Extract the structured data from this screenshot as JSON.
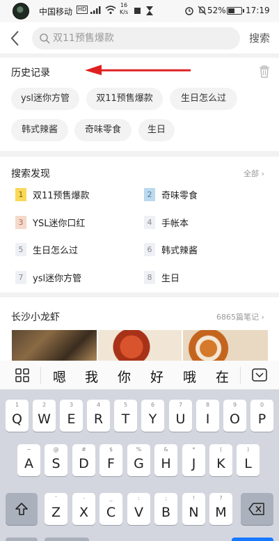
{
  "status_bar": {
    "carrier": "中国移动",
    "network_badge": "HD",
    "speed_value": "16",
    "speed_unit": "K/s",
    "battery": "52%",
    "battery_level": 0.52,
    "time": "17:19"
  },
  "search": {
    "placeholder": "双11预售爆款",
    "button": "搜索"
  },
  "history": {
    "title": "历史记录",
    "chips": [
      "ysl迷你方管",
      "双11预售爆款",
      "生日怎么过",
      "韩式辣酱",
      "奇味零食",
      "生日"
    ]
  },
  "discover": {
    "title": "搜索发现",
    "all": "全部",
    "items": [
      {
        "rank": "1",
        "label": "双11预售爆款",
        "color": "#fbd85a",
        "num_color": "#7a6200"
      },
      {
        "rank": "2",
        "label": "奇味零食",
        "color": "#bcd9ee",
        "num_color": "#4f7fa3"
      },
      {
        "rank": "3",
        "label": "YSL迷你口红",
        "color": "#f4d9cc",
        "num_color": "#b36b52"
      },
      {
        "rank": "4",
        "label": "手帐本",
        "color": "#eef0f6",
        "num_color": "#888888"
      },
      {
        "rank": "5",
        "label": "生日怎么过",
        "color": "#eef0f6",
        "num_color": "#888888"
      },
      {
        "rank": "6",
        "label": "韩式辣酱",
        "color": "#eef0f6",
        "num_color": "#888888"
      },
      {
        "rank": "7",
        "label": "ysl迷你方管",
        "color": "#eef0f6",
        "num_color": "#888888"
      },
      {
        "rank": "8",
        "label": "生日",
        "color": "#eef0f6",
        "num_color": "#888888"
      }
    ]
  },
  "city": {
    "title": "长沙小龙虾",
    "notes": "6865篇笔记"
  },
  "keyboard": {
    "candidates": [
      "嗯",
      "我",
      "你",
      "好",
      "哦",
      "在"
    ],
    "row1": [
      {
        "k": "Q",
        "s": "1"
      },
      {
        "k": "W",
        "s": "2"
      },
      {
        "k": "E",
        "s": "3"
      },
      {
        "k": "R",
        "s": "4"
      },
      {
        "k": "T",
        "s": "5"
      },
      {
        "k": "Y",
        "s": "6"
      },
      {
        "k": "U",
        "s": "7"
      },
      {
        "k": "I",
        "s": "8"
      },
      {
        "k": "O",
        "s": "9"
      },
      {
        "k": "P",
        "s": "0"
      }
    ],
    "row2": [
      {
        "k": "A",
        "s": "~"
      },
      {
        "k": "S",
        "s": "@"
      },
      {
        "k": "D",
        "s": "#"
      },
      {
        "k": "F",
        "s": "$"
      },
      {
        "k": "G",
        "s": "%"
      },
      {
        "k": "H",
        "s": "&"
      },
      {
        "k": "J",
        "s": "*"
      },
      {
        "k": "K",
        "s": "("
      },
      {
        "k": "L",
        "s": ")"
      }
    ],
    "row3": [
      {
        "k": "Z",
        "s": "'"
      },
      {
        "k": "X",
        "s": "-"
      },
      {
        "k": "C",
        "s": "_"
      },
      {
        "k": "V",
        "s": ":"
      },
      {
        "k": "B",
        "s": ";"
      },
      {
        "k": "N",
        "s": "!"
      },
      {
        "k": "M",
        "s": "?"
      }
    ]
  },
  "colors": {
    "accent": "#1677ff",
    "annotation_arrow": "#e02020"
  }
}
